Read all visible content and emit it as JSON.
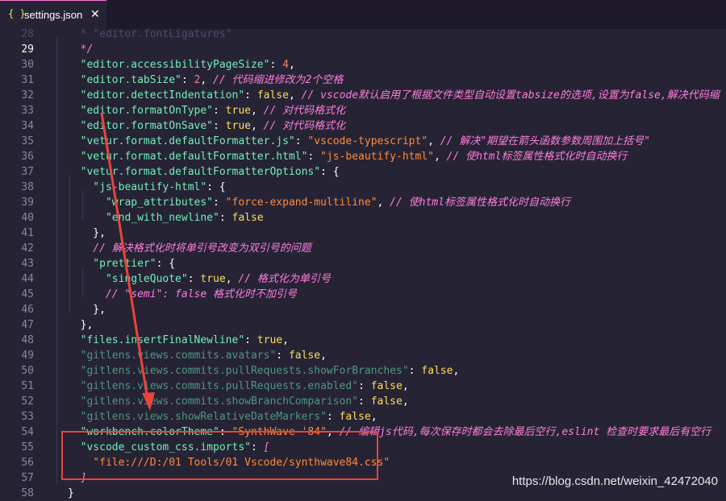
{
  "tab": {
    "icon": "{ }",
    "title": "settings.json",
    "close": "✕"
  },
  "lines": [
    {
      "num": "28",
      "segs": [
        {
          "t": "  * ",
          "c": "ci"
        },
        {
          "t": "\"editor.fontLigatures\"",
          "c": "ci"
        }
      ]
    },
    {
      "num": "29",
      "segs": [
        {
          "t": "  */",
          "c": "c"
        }
      ]
    },
    {
      "num": "30",
      "segs": [
        {
          "t": "  \"editor.accessibilityPageSize\"",
          "c": "k"
        },
        {
          "t": ": ",
          "c": "p"
        },
        {
          "t": "4",
          "c": "n"
        },
        {
          "t": ",",
          "c": "p"
        }
      ]
    },
    {
      "num": "31",
      "segs": [
        {
          "t": "  \"editor.tabSize\"",
          "c": "k"
        },
        {
          "t": ": ",
          "c": "p"
        },
        {
          "t": "2",
          "c": "n"
        },
        {
          "t": ", ",
          "c": "p"
        },
        {
          "t": "// 代码缩进修改为2个空格",
          "c": "c"
        }
      ]
    },
    {
      "num": "32",
      "segs": [
        {
          "t": "  \"editor.detectIndentation\"",
          "c": "k"
        },
        {
          "t": ": ",
          "c": "p"
        },
        {
          "t": "false",
          "c": "kw"
        },
        {
          "t": ", ",
          "c": "p"
        },
        {
          "t": "// vscode默认启用了根据文件类型自动设置tabsize的选项,设置为false,解决代码缩",
          "c": "c"
        }
      ]
    },
    {
      "num": "33",
      "segs": [
        {
          "t": "  \"editor.formatOnType\"",
          "c": "k"
        },
        {
          "t": ": ",
          "c": "p"
        },
        {
          "t": "true",
          "c": "kw"
        },
        {
          "t": ", ",
          "c": "p"
        },
        {
          "t": "// 对代码格式化",
          "c": "c"
        }
      ]
    },
    {
      "num": "34",
      "segs": [
        {
          "t": "  \"editor.formatOnSave\"",
          "c": "k"
        },
        {
          "t": ": ",
          "c": "p"
        },
        {
          "t": "true",
          "c": "kw"
        },
        {
          "t": ", ",
          "c": "p"
        },
        {
          "t": "// 对代码格式化",
          "c": "c"
        }
      ]
    },
    {
      "num": "35",
      "segs": [
        {
          "t": "  \"vetur.format.defaultFormatter.js\"",
          "c": "k"
        },
        {
          "t": ": ",
          "c": "p"
        },
        {
          "t": "\"vscode-typescript\"",
          "c": "s"
        },
        {
          "t": ", ",
          "c": "p"
        },
        {
          "t": "// 解决\"期望在箭头函数参数周围加上括号\"",
          "c": "c"
        }
      ]
    },
    {
      "num": "36",
      "segs": [
        {
          "t": "  \"vetur.format.defaultFormatter.html\"",
          "c": "k"
        },
        {
          "t": ": ",
          "c": "p"
        },
        {
          "t": "\"js-beautify-html\"",
          "c": "s"
        },
        {
          "t": ", ",
          "c": "p"
        },
        {
          "t": "// 使html标签属性格式化时自动换行",
          "c": "c"
        }
      ]
    },
    {
      "num": "37",
      "segs": [
        {
          "t": "  \"vetur.format.defaultFormatterOptions\"",
          "c": "k"
        },
        {
          "t": ": {",
          "c": "p"
        }
      ]
    },
    {
      "num": "38",
      "segs": [
        {
          "t": "    \"js-beautify-html\"",
          "c": "k"
        },
        {
          "t": ": {",
          "c": "p"
        }
      ]
    },
    {
      "num": "39",
      "segs": [
        {
          "t": "      \"wrap_attributes\"",
          "c": "k"
        },
        {
          "t": ": ",
          "c": "p"
        },
        {
          "t": "\"force-expand-multiline\"",
          "c": "s"
        },
        {
          "t": ", ",
          "c": "p"
        },
        {
          "t": "// 使html标签属性格式化时自动换行",
          "c": "c"
        }
      ]
    },
    {
      "num": "40",
      "segs": [
        {
          "t": "      \"end_with_newline\"",
          "c": "k"
        },
        {
          "t": ": ",
          "c": "p"
        },
        {
          "t": "false",
          "c": "kw"
        }
      ]
    },
    {
      "num": "41",
      "segs": [
        {
          "t": "    },",
          "c": "p"
        }
      ]
    },
    {
      "num": "42",
      "segs": [
        {
          "t": "    // 解决格式化时将单引号改变为双引号的问题",
          "c": "c"
        }
      ]
    },
    {
      "num": "43",
      "segs": [
        {
          "t": "    \"prettier\"",
          "c": "k"
        },
        {
          "t": ": {",
          "c": "p"
        }
      ]
    },
    {
      "num": "44",
      "segs": [
        {
          "t": "      \"singleQuote\"",
          "c": "k"
        },
        {
          "t": ": ",
          "c": "p"
        },
        {
          "t": "true",
          "c": "kw"
        },
        {
          "t": ", ",
          "c": "p"
        },
        {
          "t": "// 格式化为单引号",
          "c": "c"
        }
      ]
    },
    {
      "num": "45",
      "segs": [
        {
          "t": "      // \"semi\": false 格式化时不加引号",
          "c": "c"
        }
      ]
    },
    {
      "num": "46",
      "segs": [
        {
          "t": "    },",
          "c": "p"
        }
      ]
    },
    {
      "num": "47",
      "segs": [
        {
          "t": "  },",
          "c": "p"
        }
      ]
    },
    {
      "num": "48",
      "segs": [
        {
          "t": "  \"files.insertFinalNewline\"",
          "c": "k"
        },
        {
          "t": ": ",
          "c": "p"
        },
        {
          "t": "true",
          "c": "kw"
        },
        {
          "t": ",",
          "c": "p"
        }
      ]
    },
    {
      "num": "49",
      "segs": [
        {
          "t": "  \"gitlens.views.commits.avatars\"",
          "c": "k faded"
        },
        {
          "t": ": ",
          "c": "p"
        },
        {
          "t": "false",
          "c": "kw"
        },
        {
          "t": ",",
          "c": "p"
        }
      ]
    },
    {
      "num": "50",
      "segs": [
        {
          "t": "  \"gitlens.views.commits.pullRequests.showForBranches\"",
          "c": "k faded"
        },
        {
          "t": ": ",
          "c": "p"
        },
        {
          "t": "false",
          "c": "kw"
        },
        {
          "t": ",",
          "c": "p"
        }
      ]
    },
    {
      "num": "51",
      "segs": [
        {
          "t": "  \"gitlens.views.commits.pullRequests.enabled\"",
          "c": "k faded"
        },
        {
          "t": ": ",
          "c": "p"
        },
        {
          "t": "false",
          "c": "kw"
        },
        {
          "t": ",",
          "c": "p"
        }
      ]
    },
    {
      "num": "52",
      "segs": [
        {
          "t": "  \"gitlens.views.commits.showBranchComparison\"",
          "c": "k faded"
        },
        {
          "t": ": ",
          "c": "p"
        },
        {
          "t": "false",
          "c": "kw"
        },
        {
          "t": ",",
          "c": "p"
        }
      ]
    },
    {
      "num": "53",
      "segs": [
        {
          "t": "  \"gitlens.views.showRelativeDateMarkers\"",
          "c": "k faded"
        },
        {
          "t": ": ",
          "c": "p"
        },
        {
          "t": "false",
          "c": "kw"
        },
        {
          "t": ",",
          "c": "p"
        }
      ]
    },
    {
      "num": "54",
      "segs": [
        {
          "t": "  \"workbench.colorTheme\"",
          "c": "k"
        },
        {
          "t": ": ",
          "c": "p"
        },
        {
          "t": "\"SynthWave '84\"",
          "c": "s"
        },
        {
          "t": ", ",
          "c": "p"
        },
        {
          "t": "// 编辑js代码,每次保存时都会去除最后空行,eslint 检查时要求最后有空行",
          "c": "c"
        }
      ]
    },
    {
      "num": "55",
      "segs": [
        {
          "t": "  \"vscode_custom_css.imports\"",
          "c": "k"
        },
        {
          "t": ": ",
          "c": "p"
        },
        {
          "t": "[",
          "c": "c"
        }
      ]
    },
    {
      "num": "56",
      "segs": [
        {
          "t": "    \"file:///D:/01 Tools/01 Vscode/synthwave84.css\"",
          "c": "s"
        }
      ]
    },
    {
      "num": "57",
      "segs": [
        {
          "t": "  ]",
          "c": "c"
        }
      ]
    },
    {
      "num": "58",
      "segs": [
        {
          "t": "}",
          "c": "p"
        }
      ]
    }
  ],
  "watermark": "https://blog.csdn.net/weixin_42472040",
  "colors": {
    "background": "#262335",
    "annotation": "#e8453c",
    "key": "#72f1b8",
    "string": "#ff8b39",
    "comment": "#ff7edb",
    "number": "#f97e72",
    "boolean": "#fede5d"
  }
}
